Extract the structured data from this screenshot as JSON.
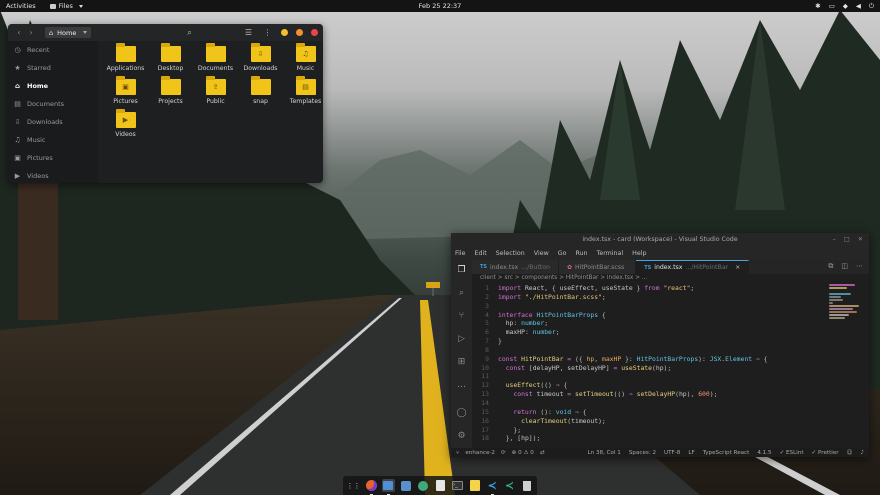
{
  "colors": {
    "accent_blue": "#4aa3df",
    "folder_yellow": "#f0c419",
    "traffic_yellow": "#f4bf2d",
    "traffic_orange": "#f3922f",
    "traffic_red": "#ef4444"
  },
  "topbar": {
    "activities": "Activities",
    "app_menu": "Files",
    "clock": "Feb 25  22:37",
    "tray_icons": [
      "bluetooth-icon",
      "battery-icon",
      "network-icon",
      "volume-icon",
      "power-icon"
    ]
  },
  "files": {
    "location": "Home",
    "sidebar": [
      {
        "label": "Recent",
        "icon": "clock-icon"
      },
      {
        "label": "Starred",
        "icon": "star-icon"
      },
      {
        "label": "Home",
        "icon": "home-icon",
        "active": true
      },
      {
        "label": "Documents",
        "icon": "document-icon"
      },
      {
        "label": "Downloads",
        "icon": "download-icon"
      },
      {
        "label": "Music",
        "icon": "music-icon"
      },
      {
        "label": "Pictures",
        "icon": "picture-icon"
      },
      {
        "label": "Videos",
        "icon": "video-icon"
      }
    ],
    "folders": [
      "Applications",
      "Desktop",
      "Documents",
      "Downloads",
      "Music",
      "Pictures",
      "Projects",
      "Public",
      "snap",
      "Templates",
      "Videos"
    ]
  },
  "vscode": {
    "title": "index.tsx - card (Workspace) - Visual Studio Code",
    "menu": [
      "File",
      "Edit",
      "Selection",
      "View",
      "Go",
      "Run",
      "Terminal",
      "Help"
    ],
    "tabs": [
      {
        "name": "index.tsx",
        "path": ".../Button",
        "kind": "TS"
      },
      {
        "name": "HitPointBar.scss",
        "path": "",
        "kind": "SCSS"
      },
      {
        "name": "index.tsx",
        "path": ".../HitPointBar",
        "kind": "TS",
        "active": true
      }
    ],
    "breadcrumbs": "client > src > components > HitPointBar > index.tsx > ...",
    "line_numbers": [
      "1",
      "2",
      "3",
      "4",
      "5",
      "6",
      "7",
      "8",
      "9",
      "10",
      "11",
      "12",
      "13",
      "14",
      "15",
      "16",
      "17",
      "18"
    ],
    "status": {
      "branch": "enhance-2",
      "sync": "⊗ 0 ⚠ 0",
      "position": "Ln 38, Col 1",
      "spaces": "Spaces: 2",
      "encoding": "UTF-8",
      "eol": "LF",
      "language": "TypeScript React",
      "version": "4.1.5",
      "eslint": "✓ ESLint",
      "prettier": "✓ Prettier"
    }
  }
}
